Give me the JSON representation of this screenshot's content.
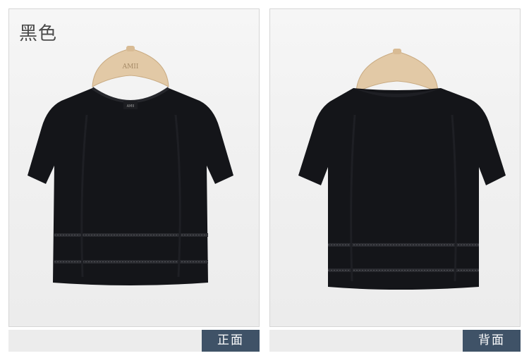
{
  "product": {
    "color_name": "黑色",
    "brand_on_hanger": "AMII",
    "brand_on_label": "AMII"
  },
  "views": [
    {
      "label": "正面"
    },
    {
      "label": "背面"
    }
  ],
  "colors": {
    "garment": "#141519",
    "hanger": "#e2c9a6",
    "tag_bg": "#3f5267",
    "bar_bg": "#ececec"
  }
}
